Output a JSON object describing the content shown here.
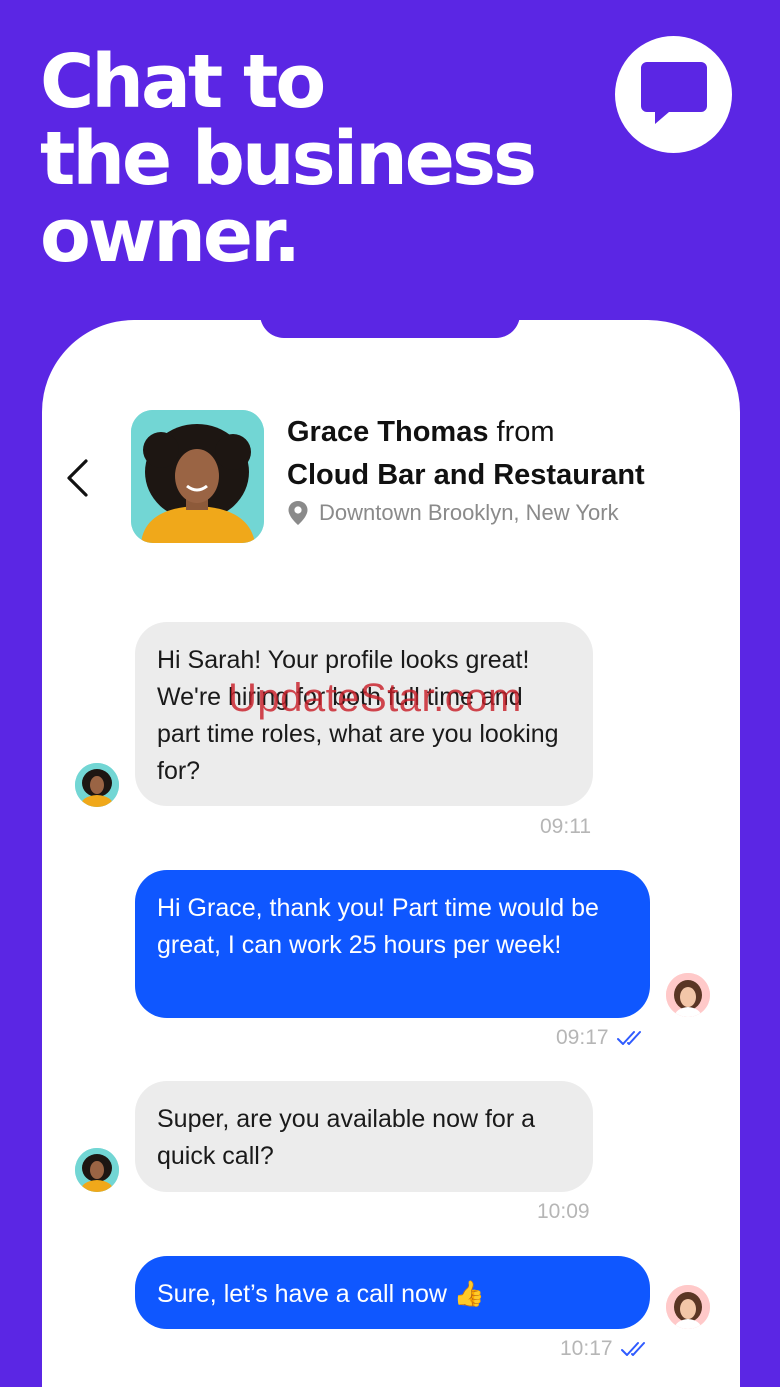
{
  "headline": {
    "line1": "Chat to",
    "line2": "the business",
    "line3": "owner."
  },
  "contact": {
    "name": "Grace Thomas",
    "connector": " from",
    "business": "Cloud Bar and Restaurant",
    "location": "Downtown Brooklyn, New York"
  },
  "messages": [
    {
      "sender": "Grace",
      "text": "Hi Sarah! Your profile looks great! We're hiring for both full time and part time roles, what are you looking for?",
      "time": "09:11"
    },
    {
      "sender": "Sarah",
      "text": "Hi Grace, thank you! Part time would be great, I can work 25 hours per week!",
      "time": "09:17",
      "read": true
    },
    {
      "sender": "Grace",
      "text": "Super, are you available now for a quick call?",
      "time": "10:09"
    },
    {
      "sender": "Sarah",
      "text": "Sure, let’s have a call now 👍",
      "time": "10:17",
      "read": true
    }
  ],
  "watermark": "UpdateStar.com",
  "colors": {
    "background": "#5B26E4",
    "outgoing_bubble": "#0F57FF",
    "incoming_bubble": "#ECECEC",
    "read_ticks": "#2F5BFF"
  },
  "icons": {
    "badge": "chat-bubble-icon",
    "back": "chevron-left-icon",
    "location": "location-pin-icon",
    "read": "double-check-icon"
  }
}
